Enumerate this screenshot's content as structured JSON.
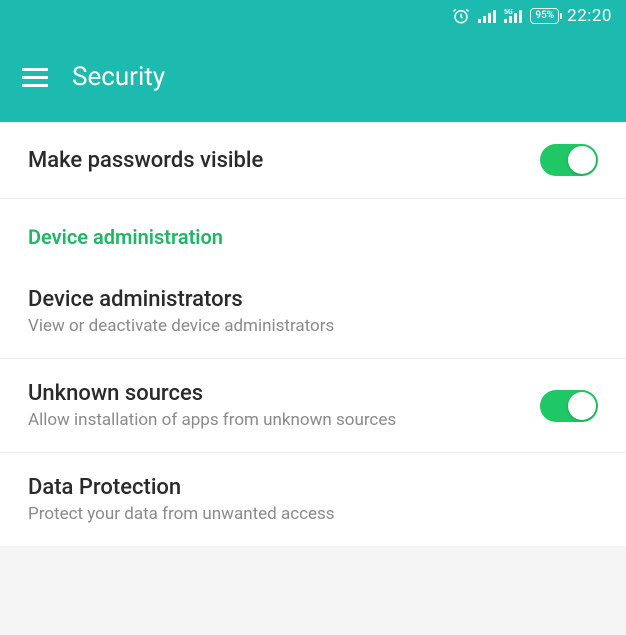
{
  "status": {
    "battery": "95%",
    "time": "22:20"
  },
  "header": {
    "title": "Security"
  },
  "items": {
    "passwords": {
      "title": "Make passwords visible"
    },
    "section_device_admin": "Device administration",
    "device_admins": {
      "title": "Device administrators",
      "subtitle": "View or deactivate device administrators"
    },
    "unknown_sources": {
      "title": "Unknown sources",
      "subtitle": "Allow installation of apps from unknown sources"
    },
    "data_protection": {
      "title": "Data Protection",
      "subtitle": "Protect your data from unwanted access"
    }
  }
}
